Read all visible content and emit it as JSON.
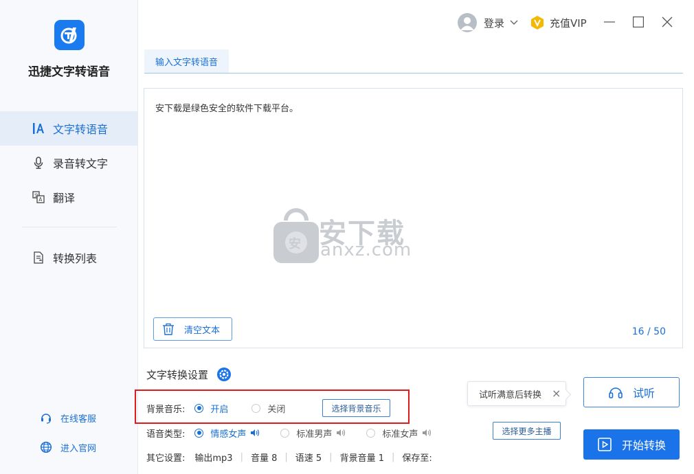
{
  "app": {
    "name": "迅捷文字转语音",
    "accent_color": "#1a73e8"
  },
  "sidebar": {
    "items": [
      {
        "label": "文字转语音",
        "icon": "text-a-icon",
        "active": true
      },
      {
        "label": "录音转文字",
        "icon": "microphone-icon",
        "active": false
      },
      {
        "label": "翻译",
        "icon": "translate-icon",
        "active": false
      },
      {
        "label": "转换列表",
        "icon": "convert-list-icon",
        "active": false
      }
    ],
    "bottom_links": [
      {
        "label": "在线客服",
        "icon": "headset-support-icon"
      },
      {
        "label": "进入官网",
        "icon": "globe-icon"
      }
    ]
  },
  "titlebar": {
    "login_label": "登录",
    "vip_label": "充值VIP",
    "vip_color": "#f5b800"
  },
  "tabs": [
    {
      "label": "输入文字转语音",
      "active": true
    }
  ],
  "editor": {
    "text": "安下载是绿色安全的软件下载平台。",
    "clear_label": "清空文本",
    "counter": "16 / 50",
    "watermark": {
      "main": "安下载",
      "sub": "anxz.com",
      "badge": "安"
    }
  },
  "settings": {
    "title": "文字转换设置",
    "background_music": {
      "label": "背景音乐:",
      "options": [
        {
          "label": "开启",
          "selected": true
        },
        {
          "label": "关闭",
          "selected": false
        }
      ],
      "choose_label": "选择背景音乐"
    },
    "voice_type": {
      "label": "语音类型:",
      "options": [
        {
          "label": "情感女声",
          "selected": true
        },
        {
          "label": "标准男声",
          "selected": false
        },
        {
          "label": "标准女声",
          "selected": false
        }
      ],
      "more_label": "选择更多主播"
    },
    "other": {
      "label": "其它设置:",
      "values": [
        "输出mp3",
        "音量 8",
        "语速 5",
        "背景音量 1",
        "保存至:"
      ]
    }
  },
  "actions": {
    "tooltip": "试听满意后转换",
    "listen_label": "试听",
    "convert_label": "开始转换"
  }
}
